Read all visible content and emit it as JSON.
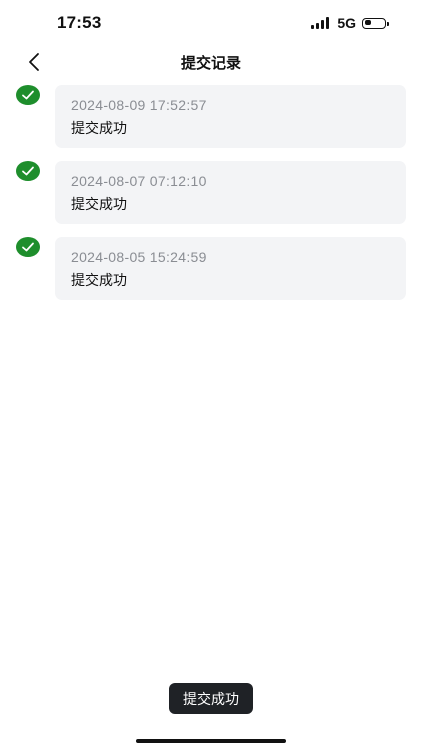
{
  "status_bar": {
    "time": "17:53",
    "network": "5G",
    "signal_bars": 4,
    "battery_level": 0.35
  },
  "nav": {
    "title": "提交记录",
    "back_icon": "chevron-left-icon"
  },
  "records": [
    {
      "time": "2024-08-09 17:52:57",
      "status": "提交成功",
      "icon": "check-circle-icon"
    },
    {
      "time": "2024-08-07 07:12:10",
      "status": "提交成功",
      "icon": "check-circle-icon"
    },
    {
      "time": "2024-08-05 15:24:59",
      "status": "提交成功",
      "icon": "check-circle-icon"
    }
  ],
  "toast": {
    "message": "提交成功"
  },
  "colors": {
    "success": "#1e8e2c",
    "card_bg": "#f3f4f6",
    "toast_bg": "#1f2226",
    "muted_text": "#8a8d93"
  }
}
